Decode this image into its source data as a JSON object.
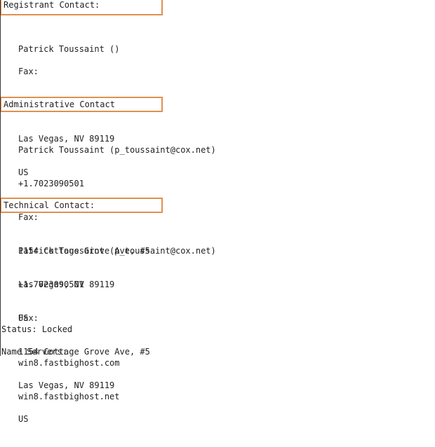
{
  "document": {
    "type": "whois-record",
    "sections": [
      {
        "id": "registrant",
        "header": "Registrant Contact:",
        "name_line": "Patrick Toussaint ()",
        "phone": "",
        "fax_label": "Fax:",
        "address_line1": "1154 Cottage Grove Ave, #5",
        "address_line2": "Las Vegas, NV 89119",
        "country": "US"
      },
      {
        "id": "administrative",
        "header": "Administrative Contact",
        "name_line": "Patrick Toussaint (p_toussaint@cox.net)",
        "phone": "+1.7023090501",
        "fax_label": "Fax:",
        "address_line1": "1154 Cottage Grove Ave, #5",
        "address_line2": "Las Vegas, NV 89119",
        "country": "US"
      },
      {
        "id": "technical",
        "header": "Technical Contact:",
        "name_line": "Patrick Toussaint (p_toussaint@cox.net)",
        "phone": "+1.7023090501",
        "fax_label": "Fax:",
        "address_line1": "1154 Cottage Grove Ave, #5",
        "address_line2": "Las Vegas, NV 89119",
        "country": "US"
      }
    ],
    "status_line": "Status: Locked",
    "name_servers_label": "Name Servers:",
    "name_servers": [
      "win8.fastbighost.com",
      "win8.fastbighost.net"
    ]
  },
  "colors": {
    "header_border": "#e09050",
    "text": "#222222",
    "background": "#ffffff",
    "page_rule": "#3a3a3a"
  }
}
